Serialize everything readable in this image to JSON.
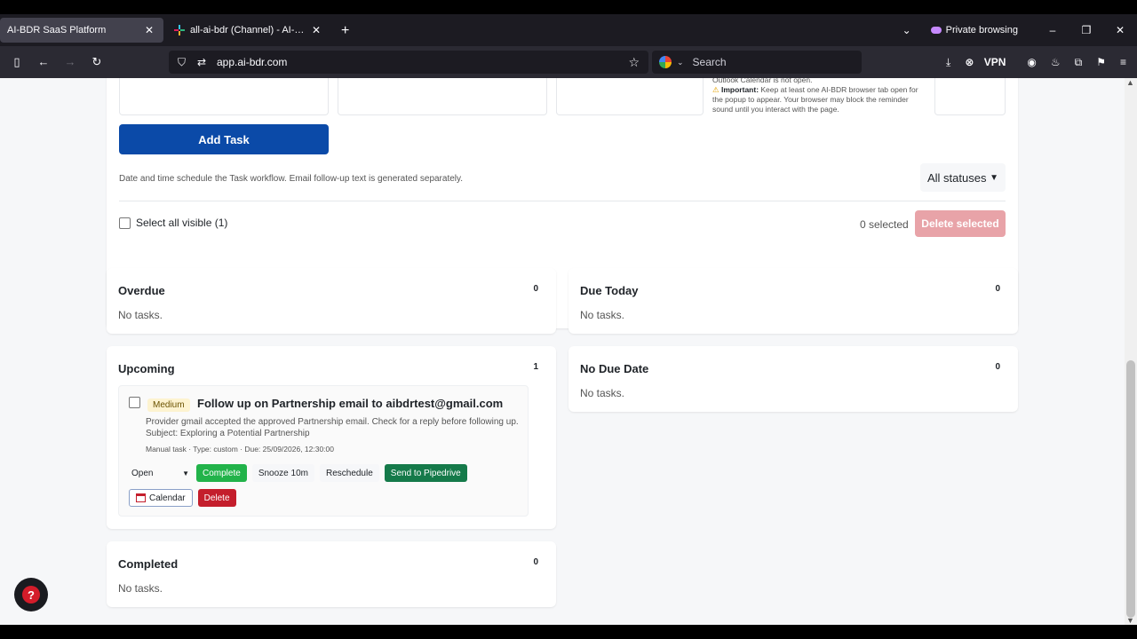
{
  "browser": {
    "tabs": [
      {
        "title": "AI-BDR SaaS Platform",
        "active": true
      },
      {
        "title": "all-ai-bdr (Channel) - AI-BDR - S",
        "active": false
      }
    ],
    "private_label": "Private browsing",
    "url": "app.ai-bdr.com",
    "search_placeholder": "Search",
    "vpn_label": "VPN"
  },
  "top_panel": {
    "note_line1": "Outlook Calendar is not open.",
    "note_important_label": "Important:",
    "note_important_text": " Keep at least one AI-BDR browser tab open for the popup to appear. Your browser may block the reminder sound until you interact with the page.",
    "add_task_label": "Add Task",
    "hint": "Date and time schedule the Task workflow. Email follow-up text is generated separately.",
    "status_filter": "All statuses",
    "select_all_label": "Select all visible (1)",
    "selected_count": "0 selected",
    "delete_selected_label": "Delete selected"
  },
  "columns": {
    "overdue": {
      "title": "Overdue",
      "count": "0",
      "empty": "No tasks."
    },
    "due_today": {
      "title": "Due Today",
      "count": "0",
      "empty": "No tasks."
    },
    "upcoming": {
      "title": "Upcoming",
      "count": "1"
    },
    "no_due_date": {
      "title": "No Due Date",
      "count": "0",
      "empty": "No tasks."
    },
    "completed": {
      "title": "Completed",
      "count": "0",
      "empty": "No tasks."
    }
  },
  "task": {
    "priority": "Medium",
    "title": "Follow up on Partnership email to aibdrtest@gmail.com",
    "desc_line1": "Provider gmail accepted the approved Partnership email. Check for a reply before following up.",
    "desc_line2": "Subject: Exploring a Potential Partnership",
    "meta": "Manual task · Type: custom · Due: 25/09/2026, 12:30:00",
    "status": "Open",
    "complete_label": "Complete",
    "snooze_label": "Snooze 10m",
    "reschedule_label": "Reschedule",
    "pipedrive_label": "Send to Pipedrive",
    "calendar_label": "Calendar",
    "delete_label": "Delete"
  },
  "help_label": "?"
}
